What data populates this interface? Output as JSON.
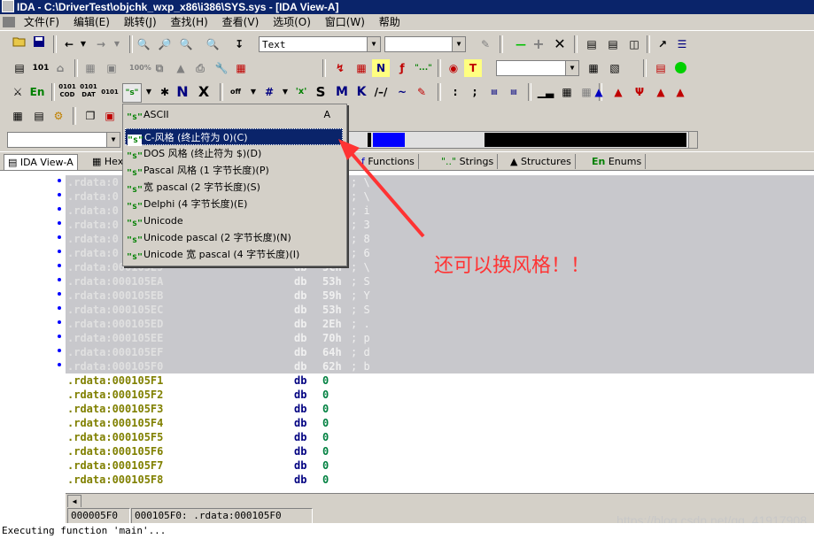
{
  "window": {
    "title": "IDA - C:\\DriverTest\\objchk_wxp_x86\\i386\\SYS.sys - [IDA View-A]"
  },
  "menu": [
    "文件(F)",
    "编辑(E)",
    "跳转(J)",
    "查找(H)",
    "查看(V)",
    "选项(O)",
    "窗口(W)",
    "帮助"
  ],
  "toolbar": {
    "text_combo": "Text",
    "icons": {
      "save": "save-icon",
      "open": "open-icon",
      "back": "back-arrow-icon",
      "forward": "forward-arrow-icon",
      "search": "binoculars-icon",
      "string": "string-icon",
      "plus": "plus-icon",
      "minus": "minus-icon",
      "close": "close-icon"
    },
    "row2_labels": {
      "n": "N",
      "t": "T"
    },
    "row3_labels": {
      "en": "En",
      "code": "0101\nCOD",
      "dat": "0101\nDAT",
      "s_btn": "\"s\"",
      "n": "N",
      "s": "S",
      "m": "M",
      "k": "K",
      "x": "X"
    }
  },
  "tabs": [
    {
      "label": "IDA View-A",
      "active": true
    },
    {
      "label": "Hex",
      "active": false
    },
    {
      "label": "Functions",
      "active": false
    },
    {
      "label": "Strings",
      "active": false
    },
    {
      "label": "Structures",
      "active": false
    },
    {
      "label": "Enums",
      "active": false
    }
  ],
  "tab_prefix": {
    "functions": "f",
    "strings": "\"..\"",
    "enums": "En"
  },
  "dropdown": {
    "items": [
      {
        "label": "ASCII",
        "shortcut": "A",
        "highlighted": false
      },
      {
        "label": "C-风格 (终止符为 0)(C)",
        "shortcut": "",
        "highlighted": true
      },
      {
        "label": "DOS 风格 (终止符为 $)(D)",
        "shortcut": "",
        "highlighted": false
      },
      {
        "label": "Pascal 风格 (1 字节长度)(P)",
        "shortcut": "",
        "highlighted": false
      },
      {
        "label": "宽 pascal (2 字节长度)(S)",
        "shortcut": "",
        "highlighted": false
      },
      {
        "label": "Delphi (4 字节长度)(E)",
        "shortcut": "",
        "highlighted": false
      },
      {
        "label": "Unicode",
        "shortcut": "",
        "highlighted": false
      },
      {
        "label": "Unicode pascal (2 字节长度)(N)",
        "shortcut": "",
        "highlighted": false
      },
      {
        "label": "Unicode 宽 pascal (4 字节长度)(I)",
        "shortcut": "",
        "highlighted": false
      }
    ],
    "icon_text": "\"s\""
  },
  "listing": {
    "selected_rows": [
      {
        "addr": ".rdata:0",
        "mn": "",
        "op": "",
        "cm": "; \\"
      },
      {
        "addr": ".rdata:0",
        "mn": "",
        "op": "",
        "cm": "; \\"
      },
      {
        "addr": ".rdata:0",
        "mn": "",
        "op": "",
        "cm": "; i"
      },
      {
        "addr": ".rdata:0",
        "mn": "",
        "op": "",
        "cm": "; 3"
      },
      {
        "addr": ".rdata:0",
        "mn": "",
        "op": "",
        "cm": "; 8"
      },
      {
        "addr": ".rdata:0",
        "mn": "",
        "op": "",
        "cm": "; 6"
      },
      {
        "addr": ".rdata:000105E9",
        "mn": "db",
        "op": "5Ch",
        "cm": "; \\"
      },
      {
        "addr": ".rdata:000105EA",
        "mn": "db",
        "op": "53h",
        "cm": "; S"
      },
      {
        "addr": ".rdata:000105EB",
        "mn": "db",
        "op": "59h",
        "cm": "; Y"
      },
      {
        "addr": ".rdata:000105EC",
        "mn": "db",
        "op": "53h",
        "cm": "; S"
      },
      {
        "addr": ".rdata:000105ED",
        "mn": "db",
        "op": "2Eh",
        "cm": "; ."
      },
      {
        "addr": ".rdata:000105EE",
        "mn": "db",
        "op": "70h",
        "cm": "; p"
      },
      {
        "addr": ".rdata:000105EF",
        "mn": "db",
        "op": "64h",
        "cm": "; d"
      },
      {
        "addr": ".rdata:000105F0",
        "mn": "db",
        "op": "62h",
        "cm": "; b"
      }
    ],
    "rows": [
      {
        "addr": ".rdata:000105F1",
        "mn": "db",
        "op": "0"
      },
      {
        "addr": ".rdata:000105F2",
        "mn": "db",
        "op": "0"
      },
      {
        "addr": ".rdata:000105F3",
        "mn": "db",
        "op": "0"
      },
      {
        "addr": ".rdata:000105F4",
        "mn": "db",
        "op": "0"
      },
      {
        "addr": ".rdata:000105F5",
        "mn": "db",
        "op": "0"
      },
      {
        "addr": ".rdata:000105F6",
        "mn": "db",
        "op": "0"
      },
      {
        "addr": ".rdata:000105F7",
        "mn": "db",
        "op": "0"
      },
      {
        "addr": ".rdata:000105F8",
        "mn": "db",
        "op": "0"
      }
    ]
  },
  "status": {
    "offset": "000005F0",
    "location": "000105F0: .rdata:000105F0"
  },
  "output": "Executing function 'main'...",
  "watermark": "https://blog.csdn.net/qq_41917908",
  "annotation": "还可以换风格！！",
  "colors": {
    "title_bg": "#0a246a",
    "face": "#d4d0c8",
    "selection": "#c8c8cc",
    "address": "#808000",
    "mnemonic": "#000080",
    "operand": "#008040",
    "annotation": "#ff3333"
  }
}
